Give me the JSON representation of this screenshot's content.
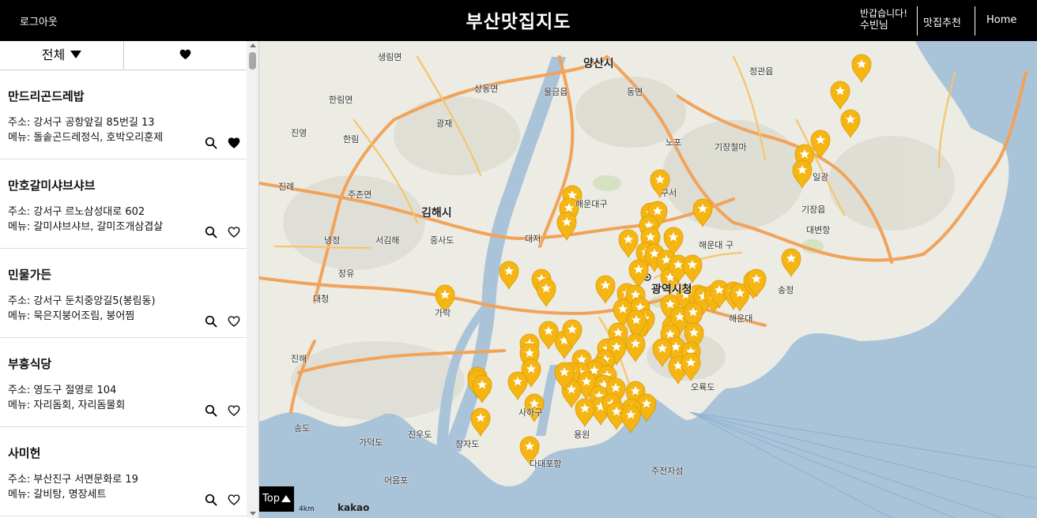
{
  "header": {
    "logout_label": "로그아웃",
    "brand": "부산맛집지도",
    "greeting": "반갑습니다!",
    "user_name": "수빈님",
    "recommend_label": "맛집추천",
    "home_label": "Home"
  },
  "tabs": {
    "all_label": "전체",
    "favorites_icon": "heart-icon"
  },
  "restaurants": [
    {
      "name": "만드리곤드레밥",
      "address": "주소: 강서구 공항앞길 85번길 13",
      "menu": "메뉴: 돌솥곤드레정식, 호박오리훈제",
      "favorited": true
    },
    {
      "name": "만호갈미샤브샤브",
      "address": "주소: 강서구 르노삼성대로 602",
      "menu": "메뉴: 갈미샤브샤브, 갈미조개삼겹살",
      "favorited": false
    },
    {
      "name": "민물가든",
      "address": "주소: 강서구 둔치중앙길5(봉림동)",
      "menu": "메뉴: 묵은지붕어조림, 붕어찜",
      "favorited": false
    },
    {
      "name": "부흥식당",
      "address": "주소: 영도구 절영로 104",
      "menu": "메뉴: 자리돔회, 자리돔물회",
      "favorited": false
    },
    {
      "name": "사미헌",
      "address": "주소: 부산진구 서면문화로 19",
      "menu": "메뉴: 갈비탕, 명장세트",
      "favorited": false
    }
  ],
  "map": {
    "labels": [
      "양산시",
      "김해시",
      "광역시청",
      "해운대",
      "송정",
      "기장읍",
      "기장철마",
      "정관읍",
      "일광",
      "대변항",
      "생림면",
      "상동면",
      "물금읍",
      "동면",
      "한림면",
      "진영",
      "한림",
      "광재",
      "주촌면",
      "진례",
      "냉정",
      "서김해",
      "장유",
      "대청",
      "진해",
      "가락",
      "대저",
      "중사도",
      "해운대구",
      "구서",
      "노포",
      "오륙도",
      "송도",
      "가덕도",
      "진우도",
      "장자도",
      "다대포항",
      "어음포",
      "주전자섬",
      "사하구",
      "용원",
      "해운대 구"
    ],
    "scale_label": "4km",
    "attribution": "kakao",
    "top_button": "Top",
    "colors": {
      "sea": "#a9c3d9",
      "land": "#ecebe4",
      "highway": "#f1a35a",
      "marker": "#f5b614"
    }
  }
}
